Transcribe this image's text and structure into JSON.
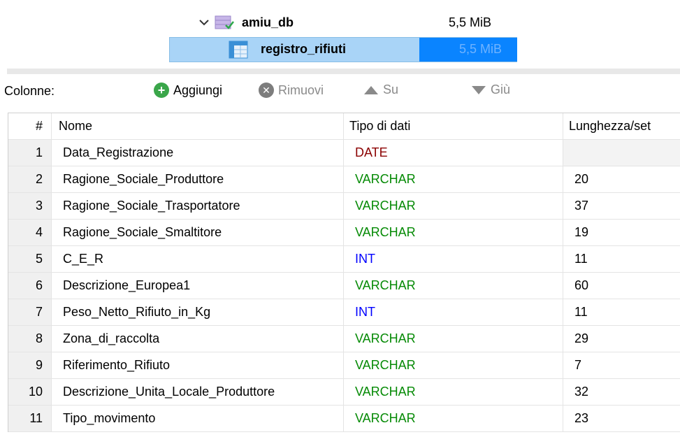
{
  "tree": {
    "database": {
      "name": "amiu_db",
      "size": "5,5 MiB",
      "icon": "database-check-icon"
    },
    "table": {
      "name": "registro_rifiuti",
      "size": "5,5 MiB",
      "icon": "table-grid-icon"
    }
  },
  "toolbar": {
    "label": "Colonne:",
    "add_label": "Aggiungi",
    "remove_label": "Rimuovi",
    "up_label": "Su",
    "down_label": "Giù"
  },
  "grid": {
    "headers": [
      "#",
      "Nome",
      "Tipo di dati",
      "Lunghezza/set"
    ],
    "rows": [
      {
        "num": "1",
        "name": "Data_Registrazione",
        "type": "DATE",
        "length": ""
      },
      {
        "num": "2",
        "name": "Ragione_Sociale_Produttore",
        "type": "VARCHAR",
        "length": "20"
      },
      {
        "num": "3",
        "name": "Ragione_Sociale_Trasportatore",
        "type": "VARCHAR",
        "length": "37"
      },
      {
        "num": "4",
        "name": "Ragione_Sociale_Smaltitore",
        "type": "VARCHAR",
        "length": "19"
      },
      {
        "num": "5",
        "name": "C_E_R",
        "type": "INT",
        "length": "11"
      },
      {
        "num": "6",
        "name": "Descrizione_Europea1",
        "type": "VARCHAR",
        "length": "60"
      },
      {
        "num": "7",
        "name": "Peso_Netto_Rifiuto_in_Kg",
        "type": "INT",
        "length": "11"
      },
      {
        "num": "8",
        "name": "Zona_di_raccolta",
        "type": "VARCHAR",
        "length": "29"
      },
      {
        "num": "9",
        "name": "Riferimento_Rifiuto",
        "type": "VARCHAR",
        "length": "7"
      },
      {
        "num": "10",
        "name": "Descrizione_Unita_Locale_Produttore",
        "type": "VARCHAR",
        "length": "32"
      },
      {
        "num": "11",
        "name": "Tipo_movimento",
        "type": "VARCHAR",
        "length": "23"
      }
    ]
  },
  "colors": {
    "date": "#8b0000",
    "varchar": "#058a05",
    "int": "#0000ff",
    "selection": "#a9d4f7",
    "size_bar": "#0a84ff"
  }
}
